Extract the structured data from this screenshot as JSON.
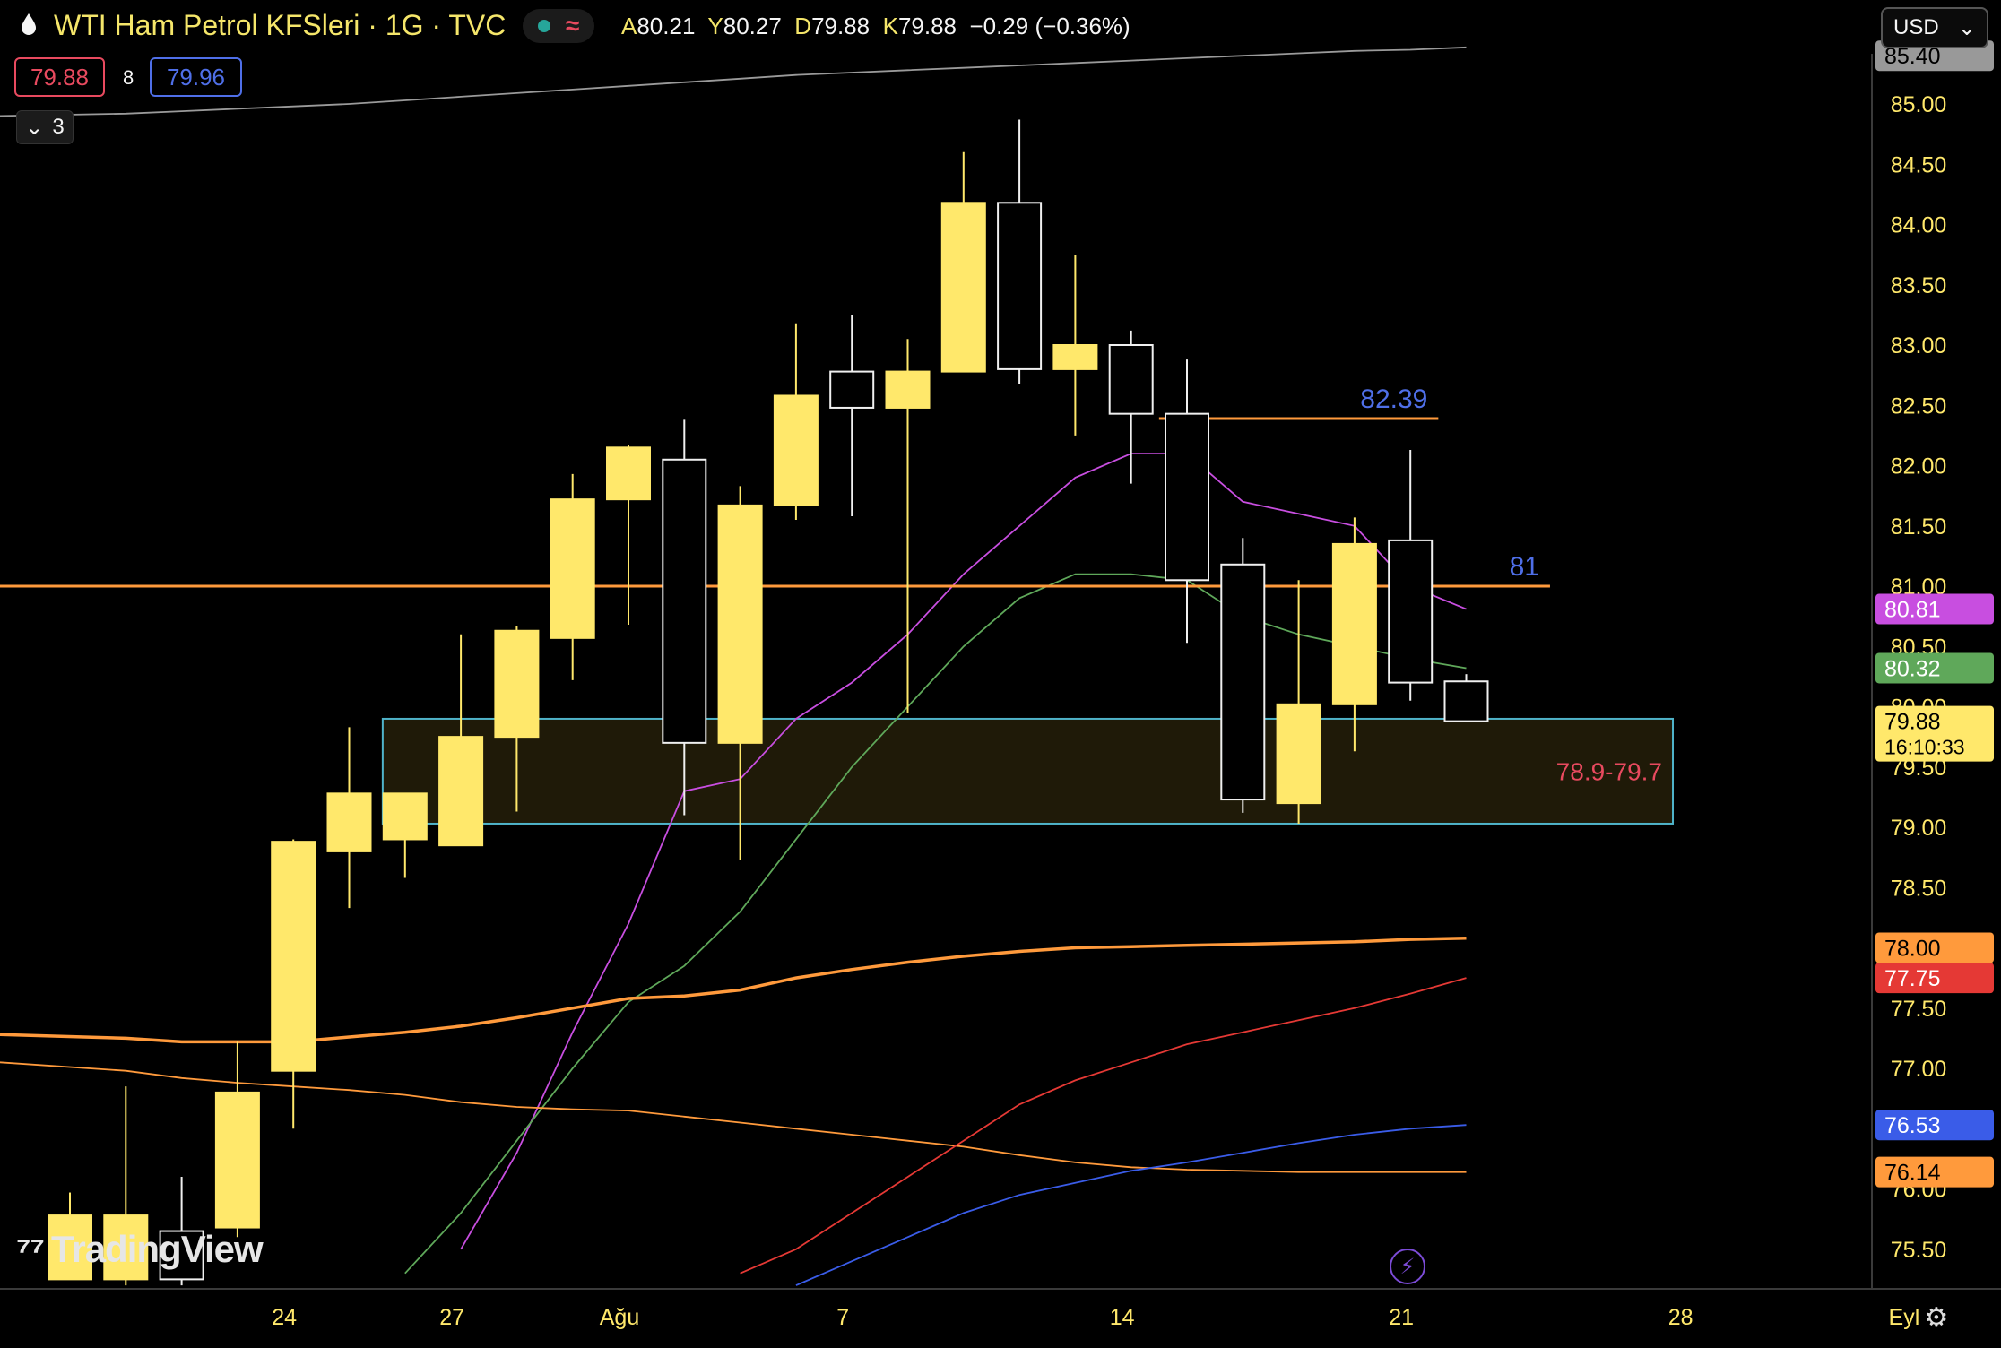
{
  "header": {
    "title": "WTI Ham Petrol KFSleri · 1G · TVC",
    "ohlc": [
      {
        "k": "A",
        "v": "80.21"
      },
      {
        "k": "Y",
        "v": "80.27"
      },
      {
        "k": "D",
        "v": "79.88"
      },
      {
        "k": "K",
        "v": "79.88"
      }
    ],
    "change": "−0.29 (−0.36%)",
    "bid": "79.88",
    "spread": "8",
    "ask": "79.96",
    "indicators_count": "3",
    "currency": "USD"
  },
  "branding": {
    "logo_text": "TradingView"
  },
  "colors": {
    "bull": "#ffe86b",
    "bear_outline": "#f0f0f0",
    "ema_purple": "#c84ee0",
    "ema_green": "#5fa85a",
    "ma_orange": "#ff9a3c",
    "ma_red": "#e53935",
    "ma_blue": "#3a5ce8",
    "zone_border": "#4fb3c9",
    "zone_fill": "#1f1a08",
    "level_line": "#ff9a3c",
    "level_label": "#4f6fe8",
    "zone_label": "#e84a5f"
  },
  "chart_data": {
    "type": "candlestick",
    "ylim": [
      75.2,
      85.6
    ],
    "y_ticks": [
      "85.00",
      "84.50",
      "84.00",
      "83.50",
      "83.00",
      "82.50",
      "82.00",
      "81.50",
      "81.00",
      "80.50",
      "80.00",
      "79.50",
      "79.00",
      "78.50",
      "78.00",
      "77.50",
      "77.00",
      "76.50",
      "76.00",
      "75.50"
    ],
    "x_ticks": [
      {
        "label": "24",
        "index": 4
      },
      {
        "label": "27",
        "index": 7
      },
      {
        "label": "Ağu",
        "index": 10
      },
      {
        "label": "7",
        "index": 14
      },
      {
        "label": "14",
        "index": 19
      },
      {
        "label": "21",
        "index": 24
      },
      {
        "label": "28",
        "index": 29
      },
      {
        "label": "Eyl",
        "index": 33
      }
    ],
    "candles": [
      {
        "o": 75.25,
        "h": 75.97,
        "l": 75.25,
        "c": 75.78
      },
      {
        "o": 75.25,
        "h": 76.85,
        "l": 75.2,
        "c": 75.78
      },
      {
        "o": 75.65,
        "h": 76.1,
        "l": 75.2,
        "c": 75.25
      },
      {
        "o": 75.68,
        "h": 77.22,
        "l": 75.6,
        "c": 76.8
      },
      {
        "o": 76.98,
        "h": 78.9,
        "l": 76.5,
        "c": 78.88
      },
      {
        "o": 78.8,
        "h": 79.83,
        "l": 78.33,
        "c": 79.28
      },
      {
        "o": 78.9,
        "h": 79.28,
        "l": 78.58,
        "c": 79.28
      },
      {
        "o": 78.85,
        "h": 80.6,
        "l": 78.85,
        "c": 79.75
      },
      {
        "o": 79.75,
        "h": 80.67,
        "l": 79.13,
        "c": 80.63
      },
      {
        "o": 80.57,
        "h": 81.93,
        "l": 80.22,
        "c": 81.72
      },
      {
        "o": 81.72,
        "h": 82.17,
        "l": 80.68,
        "c": 82.15
      },
      {
        "o": 82.05,
        "h": 82.38,
        "l": 79.1,
        "c": 79.7
      },
      {
        "o": 79.7,
        "h": 81.83,
        "l": 78.73,
        "c": 81.67
      },
      {
        "o": 81.67,
        "h": 83.18,
        "l": 81.55,
        "c": 82.58
      },
      {
        "o": 82.78,
        "h": 83.25,
        "l": 81.58,
        "c": 82.48
      },
      {
        "o": 82.48,
        "h": 83.05,
        "l": 79.95,
        "c": 82.78
      },
      {
        "o": 82.78,
        "h": 84.6,
        "l": 82.78,
        "c": 84.18
      },
      {
        "o": 84.18,
        "h": 84.87,
        "l": 82.68,
        "c": 82.8
      },
      {
        "o": 82.8,
        "h": 83.75,
        "l": 82.25,
        "c": 83.0
      },
      {
        "o": 83.0,
        "h": 83.12,
        "l": 81.85,
        "c": 82.43
      },
      {
        "o": 82.43,
        "h": 82.88,
        "l": 80.53,
        "c": 81.05
      },
      {
        "o": 81.18,
        "h": 81.4,
        "l": 79.12,
        "c": 79.23
      },
      {
        "o": 79.2,
        "h": 81.05,
        "l": 79.03,
        "c": 80.02
      },
      {
        "o": 80.02,
        "h": 81.57,
        "l": 79.63,
        "c": 81.35
      },
      {
        "o": 81.38,
        "h": 82.13,
        "l": 80.05,
        "c": 80.2
      },
      {
        "o": 80.21,
        "h": 80.27,
        "l": 79.88,
        "c": 79.88
      }
    ],
    "series": [
      {
        "color_key": "ema_purple",
        "values": [
          null,
          null,
          null,
          null,
          null,
          null,
          null,
          75.5,
          76.3,
          77.3,
          78.2,
          79.3,
          79.4,
          79.9,
          80.2,
          80.6,
          81.1,
          81.5,
          81.9,
          82.1,
          82.1,
          81.7,
          81.6,
          81.5,
          81.0,
          80.81
        ]
      },
      {
        "color_key": "ema_green",
        "values": [
          null,
          null,
          null,
          null,
          null,
          null,
          75.3,
          75.8,
          76.4,
          77.0,
          77.55,
          77.85,
          78.3,
          78.9,
          79.5,
          80.0,
          80.5,
          80.9,
          81.1,
          81.1,
          81.05,
          80.75,
          80.6,
          80.5,
          80.4,
          80.32
        ]
      },
      {
        "color_key": "ma_orange",
        "values": [
          77.28,
          77.25,
          77.22,
          77.22,
          77.22,
          77.26,
          77.3,
          77.35,
          77.42,
          77.5,
          77.58,
          77.6,
          77.65,
          77.75,
          77.82,
          77.88,
          77.93,
          77.97,
          78.0,
          78.01,
          78.02,
          78.03,
          78.04,
          78.05,
          78.07,
          78.08
        ]
      },
      {
        "color_key": "ma_orange_thin",
        "values": [
          77.05,
          76.98,
          76.92,
          76.88,
          76.85,
          76.82,
          76.78,
          76.72,
          76.68,
          76.66,
          76.65,
          76.6,
          76.55,
          76.5,
          76.45,
          76.4,
          76.35,
          76.28,
          76.22,
          76.18,
          76.16,
          76.15,
          76.14,
          76.14,
          76.14,
          76.14
        ]
      },
      {
        "color_key": "ma_red",
        "values": [
          null,
          null,
          null,
          null,
          null,
          null,
          null,
          null,
          null,
          null,
          null,
          null,
          75.3,
          75.5,
          75.8,
          76.1,
          76.4,
          76.7,
          76.9,
          77.05,
          77.2,
          77.3,
          77.4,
          77.5,
          77.62,
          77.75
        ]
      },
      {
        "color_key": "ma_blue",
        "values": [
          null,
          null,
          null,
          null,
          null,
          null,
          null,
          null,
          null,
          null,
          null,
          null,
          null,
          75.2,
          75.4,
          75.6,
          75.8,
          75.95,
          76.05,
          76.15,
          76.22,
          76.3,
          76.38,
          76.45,
          76.5,
          76.53
        ]
      },
      {
        "color_key": "ma_gray",
        "values": [
          84.9,
          84.92,
          84.94,
          84.96,
          84.98,
          85.0,
          85.03,
          85.06,
          85.09,
          85.12,
          85.15,
          85.18,
          85.21,
          85.24,
          85.26,
          85.28,
          85.3,
          85.32,
          85.34,
          85.36,
          85.38,
          85.4,
          85.42,
          85.44,
          85.45,
          85.47
        ]
      }
    ],
    "levels": [
      {
        "value": 81.0,
        "label": "81",
        "from_index": -1,
        "to_index": 26.5
      },
      {
        "value": 82.39,
        "label": "82.39",
        "from_index": 19.5,
        "to_index": 24.5
      }
    ],
    "zone": {
      "low": 79.03,
      "high": 79.9,
      "from_index": 5.6,
      "to_index": 28.7,
      "label": "78.9-79.7"
    },
    "price_badges": [
      {
        "value": 80.81,
        "text": "80.81",
        "color": "#c84ee0",
        "text_color": "#ffffff"
      },
      {
        "value": 80.32,
        "text": "80.32",
        "color": "#5fa85a",
        "text_color": "#ffffff"
      },
      {
        "value": 79.88,
        "text": "79.88",
        "sub": "16:10:33",
        "color": "#ffe86b",
        "text_color": "#000000"
      },
      {
        "value": 78.0,
        "text": "78.00",
        "color": "#ff9a3c",
        "text_color": "#000000"
      },
      {
        "value": 77.75,
        "text": "77.75",
        "color": "#e53935",
        "text_color": "#ffffff"
      },
      {
        "value": 76.53,
        "text": "76.53",
        "color": "#3a5ce8",
        "text_color": "#ffffff"
      },
      {
        "value": 76.14,
        "text": "76.14",
        "color": "#ff9a3c",
        "text_color": "#000000"
      },
      {
        "value": 85.4,
        "text": "85.40",
        "color": "#999999",
        "text_color": "#000000"
      }
    ]
  }
}
